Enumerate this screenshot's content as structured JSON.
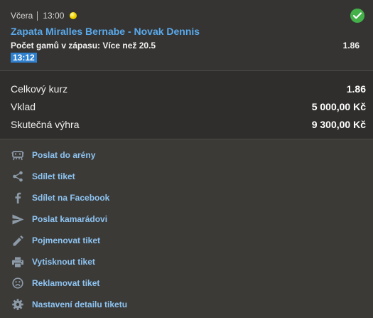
{
  "ticket": {
    "date_label": "Včera",
    "time": "13:00",
    "sport_icon": "tennis-ball-icon",
    "status_icon": "check-circle-icon",
    "match_name": "Zapata Miralles Bernabe - Novak Dennis",
    "market": "Počet gamů v zápasu: Více než 20.5",
    "odd": "1.86",
    "match_time_badge": "13:12"
  },
  "summary": {
    "total_odds_label": "Celkový kurz",
    "total_odds_value": "1.86",
    "stake_label": "Vklad",
    "stake_value": "5 000,00 Kč",
    "win_label": "Skutečná výhra",
    "win_value": "9 300,00 Kč"
  },
  "actions": [
    {
      "label": "Poslat do arény",
      "icon": "arena-icon"
    },
    {
      "label": "Sdílet tiket",
      "icon": "share-icon"
    },
    {
      "label": "Sdílet na Facebook",
      "icon": "facebook-icon"
    },
    {
      "label": "Poslat kamarádovi",
      "icon": "send-icon"
    },
    {
      "label": "Pojmenovat tiket",
      "icon": "pencil-icon"
    },
    {
      "label": "Vytisknout tiket",
      "icon": "printer-icon"
    },
    {
      "label": "Reklamovat tiket",
      "icon": "sad-face-icon"
    },
    {
      "label": "Nastavení detailu tiketu",
      "icon": "gear-icon"
    }
  ],
  "colors": {
    "accent_blue": "#5aa9ec",
    "link_blue": "#8ec4f2",
    "badge_blue": "#2f80cf",
    "success_green": "#43b049",
    "icon_grey": "#8c9aa8"
  }
}
